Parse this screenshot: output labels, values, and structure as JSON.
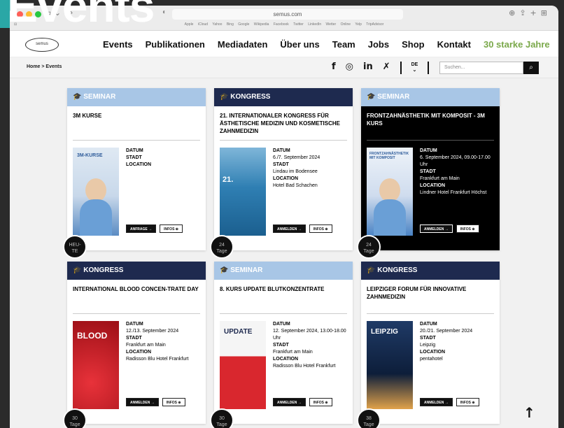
{
  "page_title_overlay": "Events",
  "browser": {
    "url": "semus.com",
    "favorites": [
      "Apple",
      "iCloud",
      "Yahoo",
      "Bing",
      "Google",
      "Wikipedia",
      "Facebook",
      "Twitter",
      "LinkedIn",
      "Wetter Online",
      "Yelp",
      "TripAdvisor"
    ]
  },
  "nav": {
    "logo_text": "semus",
    "items": [
      "Events",
      "Publikationen",
      "Mediadaten",
      "Über uns",
      "Team",
      "Jobs",
      "Shop",
      "Kontakt"
    ],
    "accent_item": "30 starke Jahre"
  },
  "subbar": {
    "breadcrumb": "Home > Events",
    "lang": "DE",
    "lang_arrow": "⌄",
    "search_placeholder": "Suchen..."
  },
  "cards": [
    {
      "type": "SEMINAR",
      "title": "3M Kurse",
      "lbl_datum": "Datum",
      "datum": "",
      "lbl_stadt": "Stadt",
      "stadt": "",
      "lbl_location": "Location",
      "location": "",
      "btn1": "Anfrage →",
      "btn2": "Infos ⊕",
      "badge_top": "HEU-",
      "badge_bottom": "TE",
      "img_text": "3M-KURSE"
    },
    {
      "type": "KONGRESS",
      "title": "21. Internationaler Kongress für ästhetische Medizin und kosmetische Zahnmedizin",
      "lbl_datum": "Datum",
      "datum": "6./7. September 2024",
      "lbl_stadt": "Stadt",
      "stadt": "Lindau im Bodensee",
      "lbl_location": "Location",
      "location": "Hotel Bad Schachen",
      "btn1": "Anmelden →",
      "btn2": "Infos ⊕",
      "badge_top": "24",
      "badge_bottom": "Tage",
      "img_text": "21."
    },
    {
      "type": "SEMINAR",
      "title": "Frontzahnästhetik mit Komposit - 3M Kurs",
      "lbl_datum": "Datum",
      "datum": "6. September 2024, 09.00-17.00 Uhr",
      "lbl_stadt": "Stadt",
      "stadt": "Frankfurt am Main",
      "lbl_location": "Location",
      "location": "Lindner Hotel Frankfurt Höchst",
      "btn1": "Anmelden →",
      "btn2": "Infos ⊕",
      "badge_top": "24",
      "badge_bottom": "Tage",
      "img_text": "FRONTZAHNÄSTHETIK MIT KOMPOSIT"
    },
    {
      "type": "KONGRESS",
      "title": "International Blood Concen-trate Day",
      "lbl_datum": "Datum",
      "datum": "12./13. September 2024",
      "lbl_stadt": "Stadt",
      "stadt": "Frankfurt am Main",
      "lbl_location": "Location",
      "location": "Radisson Blu Hotel Frankfurt",
      "btn1": "Anmelden →",
      "btn2": "Infos ⊕",
      "badge_top": "30",
      "badge_bottom": "Tage",
      "img_text": "BLOOD"
    },
    {
      "type": "SEMINAR",
      "title": "8. Kurs Update Blutkonzentrate",
      "lbl_datum": "Datum",
      "datum": "12. September 2024, 13.00-18.00 Uhr",
      "lbl_stadt": "Stadt",
      "stadt": "Frankfurt am Main",
      "lbl_location": "Location",
      "location": "Radisson Blu Hotel Frankfurt",
      "btn1": "Anmelden →",
      "btn2": "Infos ⊕",
      "badge_top": "30",
      "badge_bottom": "Tage",
      "img_text": "UPDATE"
    },
    {
      "type": "KONGRESS",
      "title": "Leipziger Forum für innovative Zahnmedizin",
      "lbl_datum": "Datum",
      "datum": "20./21. September 2024",
      "lbl_stadt": "Stadt",
      "stadt": "Leipzig",
      "lbl_location": "Location",
      "location": "pentahotel",
      "btn1": "Anmelden →",
      "btn2": "Infos ⊕",
      "badge_top": "38",
      "badge_bottom": "Tage",
      "img_text": "LEIPZIG"
    }
  ],
  "colors": {
    "seminar": "#a8c6e6",
    "kongress": "#1e2a4f",
    "accent": "#7aa84a"
  }
}
